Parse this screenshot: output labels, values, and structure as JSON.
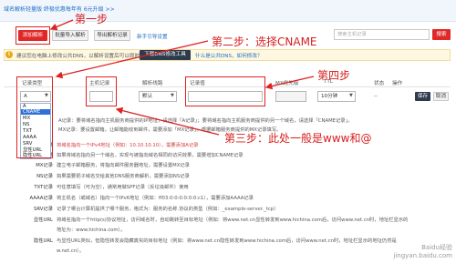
{
  "notice": {
    "text": "域名解析轻量版 终极优惠每年有 6元升级 >>"
  },
  "toolbar": {
    "add_record": "添加解析",
    "import": "批量导入解析",
    "export": "导出解析记录",
    "wizard": "新手引导设置",
    "search_placeholder": "搜索主机记录",
    "search_button": "搜索"
  },
  "tip": {
    "text": "建议您在电脑上修改公共DNS，以解析设置后可以即时生效。",
    "button": "下载DNS修改工具",
    "link": "什么是公共DNS，如何修改？"
  },
  "table": {
    "headers": [
      "记录类型",
      "主机记录",
      "解析线路",
      "记录值",
      "MX优先级",
      "TTL",
      "状态",
      "操作"
    ]
  },
  "row": {
    "type_value": "A",
    "line_value": "默认",
    "ttl_value": "10分钟",
    "status": "--",
    "save": "保存",
    "cancel": "取消"
  },
  "dropdown": {
    "options": [
      "A",
      "CNAME",
      "MX",
      "NS",
      "TXT",
      "AAAA",
      "SRV",
      "显性URL",
      "隐性URL"
    ],
    "selected": "CNAME"
  },
  "help": {
    "lines": [
      "A记录：要将域名指向主机服务商提供的IP地址，请选择「A记录」；要将域名指向主机服务商提供的另一个域名，请选择「CNAME记录」。",
      "MX记录：要设置邮箱，让邮箱能收到邮件，需要添加「MX记录」。根据邮箱服务商提供的MX记录填写。",
      "将域名指向一个IPv4地址（例如：10.10.10.10），需要添加A记录",
      "如果将域名指向另一个域名，实现与被指向域名相同的访问效果，需要增加CNAME记录",
      "建立电子邮箱服务，将指向邮件服务器地址，需要设置MX记录",
      "如果需要把子域名交给其他DNS服务商解析，需要添加NS记录",
      "可任意填写（可为空），通常用做SPF记录（反垃圾邮件）使用",
      "将主机名（或域名）指向一个IPv6地址（例如：ff03:0:0:0:0:0:0:c1），需要添加AAAA记录",
      "记录了哪台计算机提供了哪个服务。格式为：服务的名称.协议的类型（例如：_example-server._tcp）",
      "将域名指向一个http(s)协议地址，访问域名时，自动跳转至目标地址（例如：将www.net.cn显性转发到www.hichina.com后，访问www.net.cn时，地址栏显示的",
      "地址为：www.hichina.com）。",
      "与显性URL类似，但隐性转发会隐藏真实的目标地址（例如：将www.net.cn隐性转发到www.hichina.com后，访问www.net.cn时，地址栏显示的地址仍然是",
      "w.net.cn）。"
    ],
    "labels": [
      "A记录",
      "CNAME记录",
      "MX记录",
      "NS记录",
      "TXT记录",
      "AAAA记录",
      "SRV记录",
      "显性URL",
      "",
      "隐性URL",
      ""
    ]
  },
  "annotations": {
    "step1": "第一步",
    "step2": "第二步：选择CNAME",
    "step3": "第三步：此处一般是www和@",
    "step4": "第四步"
  },
  "watermark": {
    "line1": "Baidu经验",
    "line2": "jingyan.baidu.com"
  },
  "colors": {
    "accent_red": "#e02828",
    "link_blue": "#1f6cc4",
    "annotation_red": "#d71f1f",
    "selected_blue": "#2f6fd8"
  }
}
